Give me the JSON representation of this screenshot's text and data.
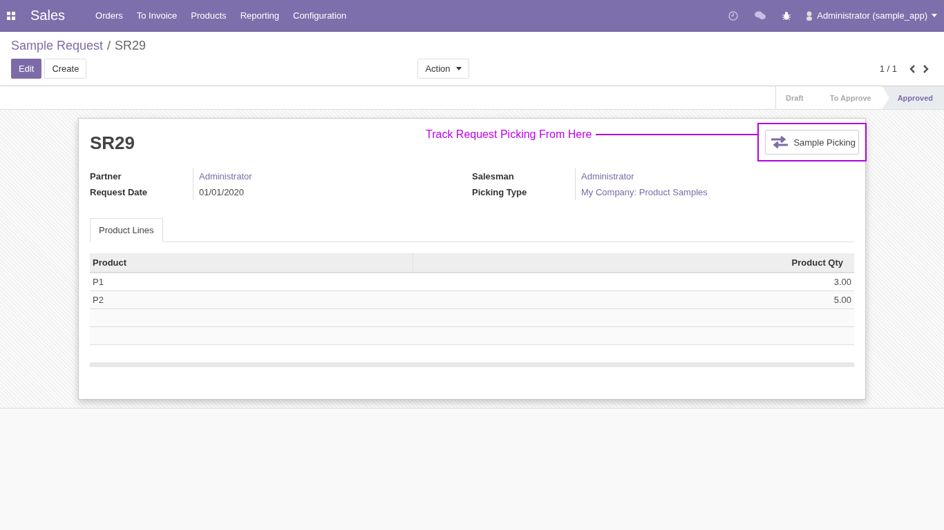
{
  "navbar": {
    "app_name": "Sales",
    "menu": [
      "Orders",
      "To Invoice",
      "Products",
      "Reporting",
      "Configuration"
    ],
    "user": "Administrator (sample_app)"
  },
  "breadcrumb": {
    "parent": "Sample Request",
    "separator": "/",
    "current": "SR29"
  },
  "buttons": {
    "edit": "Edit",
    "create": "Create",
    "action": "Action"
  },
  "pager": "1 / 1",
  "stages": [
    {
      "label": "Draft",
      "selected": false
    },
    {
      "label": "To Approve",
      "selected": false
    },
    {
      "label": "Approved",
      "selected": true
    }
  ],
  "record": {
    "title": "SR29",
    "annotation": "Track Request Picking From Here",
    "smart_button": "Sample Picking",
    "left_fields": [
      {
        "label": "Partner",
        "value": "Administrator",
        "kind": "link"
      },
      {
        "label": "Request Date",
        "value": "01/01/2020",
        "kind": "text"
      }
    ],
    "right_fields": [
      {
        "label": "Salesman",
        "value": "Administrator",
        "kind": "link"
      },
      {
        "label": "Picking Type",
        "value": "My Company: Product Samples",
        "kind": "link"
      }
    ],
    "tabs": [
      {
        "label": "Product Lines",
        "selected": true
      }
    ],
    "table": {
      "columns": [
        "Product",
        "Product Qty"
      ],
      "rows": [
        [
          "P1",
          "3.00"
        ],
        [
          "P2",
          "5.00"
        ]
      ]
    }
  }
}
